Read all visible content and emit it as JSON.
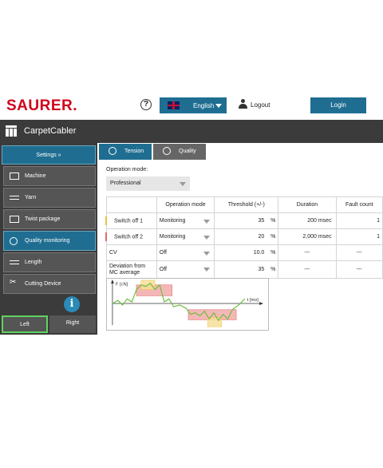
{
  "header": {
    "logo": "SAURER.",
    "help_glyph": "?",
    "language": "English",
    "logout": "Logout",
    "login": "Login"
  },
  "app": {
    "title": "CarpetCabler"
  },
  "sidebar": {
    "settings": "Settings  »",
    "items": [
      {
        "label": "Machine",
        "icon": "machine-icon"
      },
      {
        "label": "Yarn",
        "icon": "yarn-icon"
      },
      {
        "label": "Twist package",
        "icon": "package-icon"
      },
      {
        "label": "Quality monitoring",
        "icon": "quality-icon",
        "active": true
      },
      {
        "label": "Length",
        "icon": "length-icon"
      },
      {
        "label": "Cutting Device",
        "icon": "scissors-icon"
      }
    ],
    "info_glyph": "i",
    "side_left": "Left",
    "side_right": "Right"
  },
  "tabs": {
    "tension": "Tension",
    "quality": "Quality"
  },
  "operation_mode": {
    "label": "Operation mode:",
    "value": "Professional"
  },
  "table": {
    "headers": [
      "",
      "Operation mode",
      "Threshold (+/-)",
      "Duration",
      "Fault count"
    ],
    "rows": [
      {
        "name": "Switch off 1",
        "mode": "Monitoring",
        "threshold": "35",
        "threshold_unit": "%",
        "duration": "200",
        "duration_unit": "msec",
        "faults": "1"
      },
      {
        "name": "Switch off 2",
        "mode": "Monitoring",
        "threshold": "20",
        "threshold_unit": "%",
        "duration": "2,000",
        "duration_unit": "msec",
        "faults": "1"
      },
      {
        "name": "CV",
        "mode": "Off",
        "threshold": "10.0",
        "threshold_unit": "%",
        "duration": "---",
        "duration_unit": "",
        "faults": "---"
      },
      {
        "name": "Deviation from MC average",
        "mode": "Off",
        "threshold": "35",
        "threshold_unit": "%",
        "duration": "---",
        "duration_unit": "",
        "faults": "---"
      }
    ]
  },
  "diagram": {
    "y_label": "F [cN]",
    "x_label": "t [ms]"
  },
  "colors": {
    "accent": "#1f6e91",
    "dark": "#3b3b3b",
    "logo_red": "#d0021b",
    "marker_yellow": "#e8c23a",
    "marker_red": "#e26b6b",
    "selection_green": "#5fd35f"
  }
}
